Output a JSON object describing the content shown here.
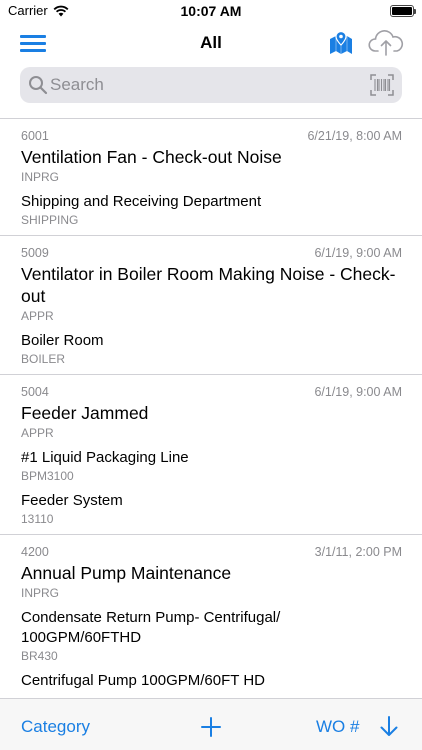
{
  "status_bar": {
    "carrier": "Carrier",
    "time": "10:07 AM"
  },
  "nav": {
    "title": "All",
    "accent_color": "#1a7fe3"
  },
  "search": {
    "placeholder": "Search"
  },
  "work_orders": [
    {
      "wonum": "6001",
      "date": "6/21/19, 8:00 AM",
      "description": "Ventilation Fan - Check-out Noise",
      "status": "INPRG",
      "lines": [
        {
          "name": "Shipping and Receiving Department",
          "code": "SHIPPING"
        }
      ]
    },
    {
      "wonum": "5009",
      "date": "6/1/19, 9:00 AM",
      "description": "Ventilator in Boiler Room Making Noise - Check-out",
      "status": "APPR",
      "lines": [
        {
          "name": "Boiler Room",
          "code": "BOILER"
        }
      ]
    },
    {
      "wonum": "5004",
      "date": "6/1/19, 9:00 AM",
      "description": "Feeder Jammed",
      "status": "APPR",
      "lines": [
        {
          "name": "#1 Liquid Packaging Line",
          "code": "BPM3100"
        },
        {
          "name": "Feeder System",
          "code": "13110"
        }
      ]
    },
    {
      "wonum": "4200",
      "date": "3/1/11, 2:00 PM",
      "description": "Annual Pump Maintenance",
      "status": "INPRG",
      "lines": [
        {
          "name": "Condensate Return Pump- Centrifugal/ 100GPM/60FTHD",
          "code": "BR430"
        },
        {
          "name": "Centrifugal Pump 100GPM/60FT HD",
          "code": ""
        }
      ]
    }
  ],
  "toolbar": {
    "category_label": "Category",
    "sort_field_label": "WO #"
  },
  "icons": {
    "menu": "hamburger-menu-icon",
    "map": "map-pin-icon",
    "cloud": "cloud-upload-icon",
    "search": "magnifier-icon",
    "barcode": "barcode-scan-icon",
    "add": "plus-icon",
    "sort": "arrow-down-icon"
  }
}
